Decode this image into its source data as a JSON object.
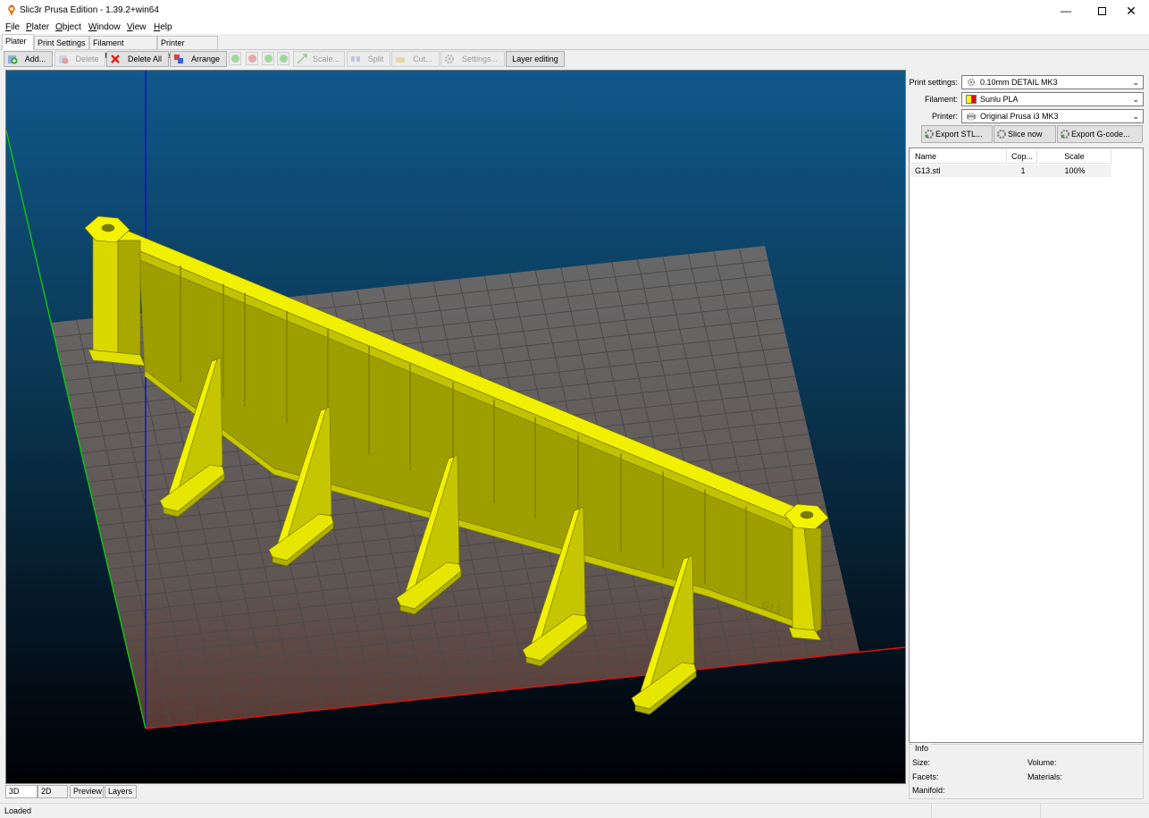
{
  "window": {
    "title": "Slic3r Prusa Edition - 1.39.2+win64"
  },
  "menu": {
    "file": {
      "acc": "F",
      "rest": "ile"
    },
    "plater": {
      "acc": "P",
      "rest": "later"
    },
    "object": {
      "acc": "O",
      "rest": "bject"
    },
    "window": {
      "acc": "W",
      "rest": "indow"
    },
    "view": {
      "acc": "V",
      "rest": "iew"
    },
    "help": {
      "acc": "H",
      "rest": "elp"
    }
  },
  "tabs": [
    "Plater",
    "Print Settings",
    "Filament Settings",
    "Printer Settings"
  ],
  "toolbar": {
    "add": "Add...",
    "delete": "Delete",
    "delete_all": "Delete All",
    "arrange": "Arrange",
    "scale": "Scale...",
    "split": "Split",
    "cut": "Cut...",
    "settings": "Settings...",
    "layer_editing": "Layer editing"
  },
  "view_tabs": [
    "3D",
    "2D",
    "Preview",
    "Layers"
  ],
  "presets": {
    "print_label": "Print settings:",
    "print_value": "0.10mm DETAIL MK3",
    "filament_label": "Filament:",
    "filament_value": "Sunlu PLA",
    "printer_label": "Printer:",
    "printer_value": "Original Prusa i3 MK3"
  },
  "actions": {
    "export_stl": "Export STL...",
    "slice_now": "Slice now",
    "export_gcode": "Export G-code..."
  },
  "object_list": {
    "columns": [
      "Name",
      "Cop...",
      "Scale"
    ],
    "rows": [
      {
        "name": "G13.stl",
        "copies": "1",
        "scale": "100%"
      }
    ]
  },
  "info": {
    "title": "Info",
    "size": "Size:",
    "volume": "Volume:",
    "facets": "Facets:",
    "materials": "Materials:",
    "manifold": "Manifold:"
  },
  "status": {
    "text": "Loaded"
  },
  "colors": {
    "model_yellow": "#e6e600",
    "axis_x": "#e01010",
    "axis_y": "#10c010",
    "axis_z": "#1010d0",
    "bed_grid": "#4a4a4a"
  },
  "icons": {
    "app": "slic3r-logo-icon",
    "add": "add-icon",
    "delete": "delete-icon",
    "delete_all": "delete-all-x-icon",
    "arrange": "arrange-icon",
    "print_preset": "gear-icon",
    "filament_preset": "filament-color-icon",
    "printer_preset": "printer-icon"
  }
}
